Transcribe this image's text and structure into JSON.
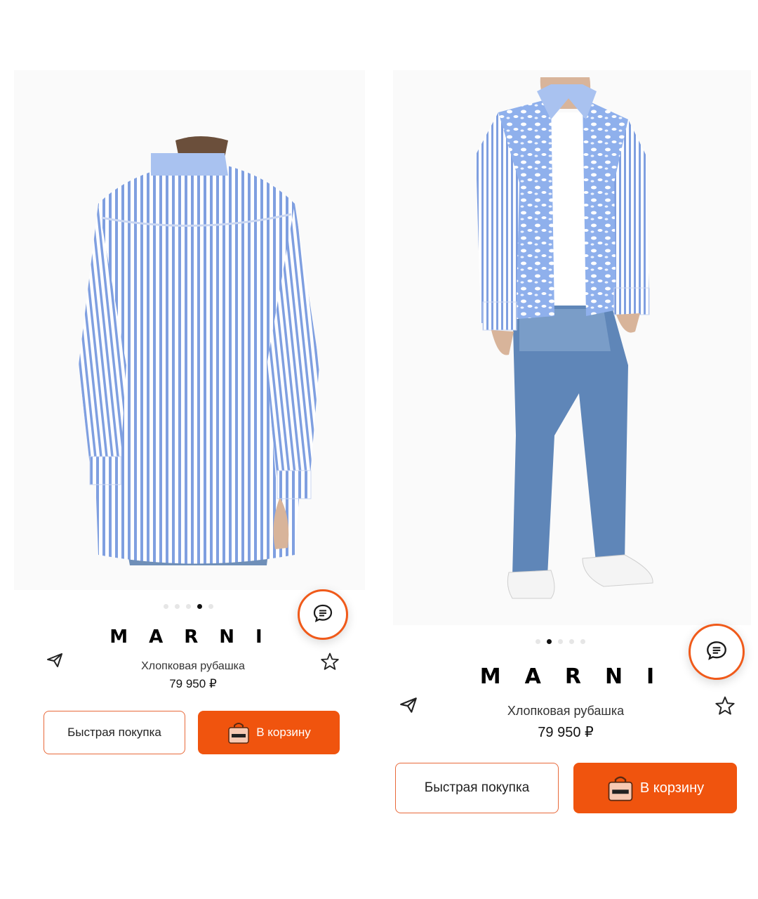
{
  "cards": [
    {
      "id": "left",
      "image_alt": "shirt-back-view",
      "carousel": {
        "count": 5,
        "active_index": 3
      },
      "brand": "MARNI",
      "product_name": "Хлопковая рубашка",
      "price": "79 950 ₽",
      "quick_buy_label": "Быстрая покупка",
      "add_to_cart_label": "В корзину",
      "icons": {
        "chat": "chat-icon",
        "share": "send-icon",
        "favorite": "star-icon",
        "cart": "shopping-bag-icon"
      }
    },
    {
      "id": "right",
      "image_alt": "model-full-length-front-view",
      "carousel": {
        "count": 5,
        "active_index": 1
      },
      "brand": "MARNI",
      "product_name": "Хлопковая рубашка",
      "price": "79 950 ₽",
      "quick_buy_label": "Быстрая покупка",
      "add_to_cart_label": "В корзину",
      "icons": {
        "chat": "chat-icon",
        "share": "send-icon",
        "favorite": "star-icon",
        "cart": "shopping-bag-icon"
      }
    }
  ],
  "colors": {
    "accent": "#f0540e",
    "text": "#1a1a1a",
    "shirt_blue": "#8aa9e6"
  }
}
